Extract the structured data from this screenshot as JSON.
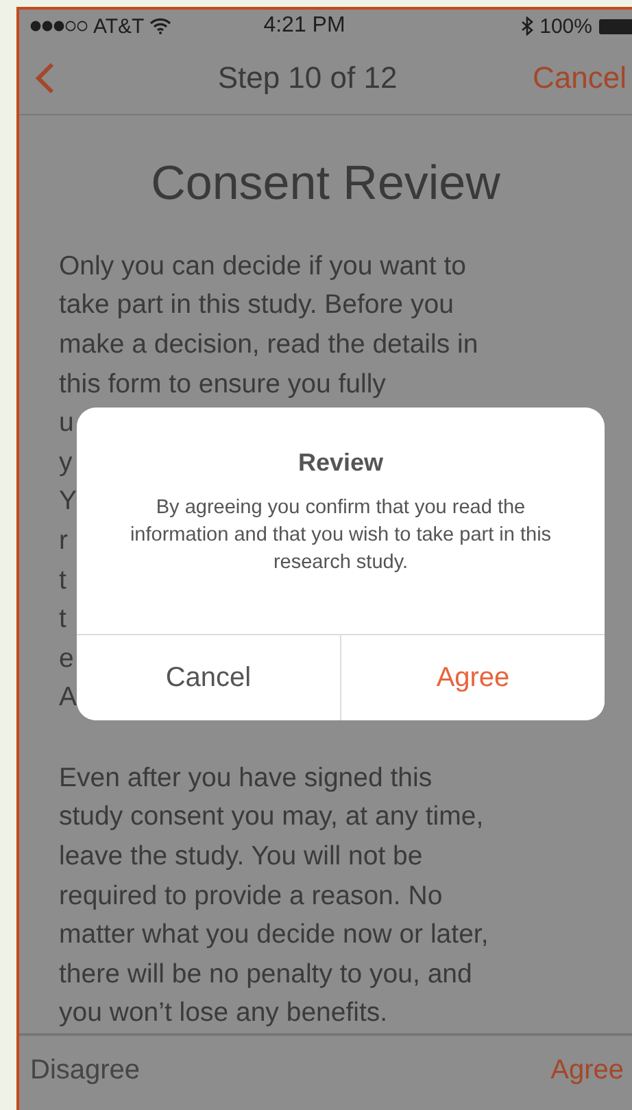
{
  "status_bar": {
    "carrier": "AT&T",
    "time": "4:21 PM",
    "battery": "100%"
  },
  "nav": {
    "title": "Step 10 of 12",
    "cancel": "Cancel"
  },
  "heading": "Consent Review",
  "paragraph_1": [
    "Only you can decide if you want to",
    "take part in this study.  Before you",
    "make a decision, read the details in",
    "this form to ensure you fully"
  ],
  "covered_fragments": [
    "u",
    "y",
    "Y",
    "r",
    "t",
    "t",
    "e",
    "A"
  ],
  "paragraph_2": [
    "Even after you have signed this",
    "study consent you may, at any time,",
    "leave the study. You will not be",
    "required to provide a reason. No",
    "matter what you decide now or later,",
    "there will be no penalty to you, and",
    "you won’t lose any benefits."
  ],
  "dialog": {
    "title": "Review",
    "message": "By agreeing you confirm that you read the information and that you wish to take part in this research study.",
    "buttons": [
      {
        "label": "Cancel",
        "kind": "cancel"
      },
      {
        "label": "Agree",
        "kind": "primary"
      }
    ]
  },
  "footer": {
    "disagree": "Disagree",
    "agree": "Agree"
  }
}
